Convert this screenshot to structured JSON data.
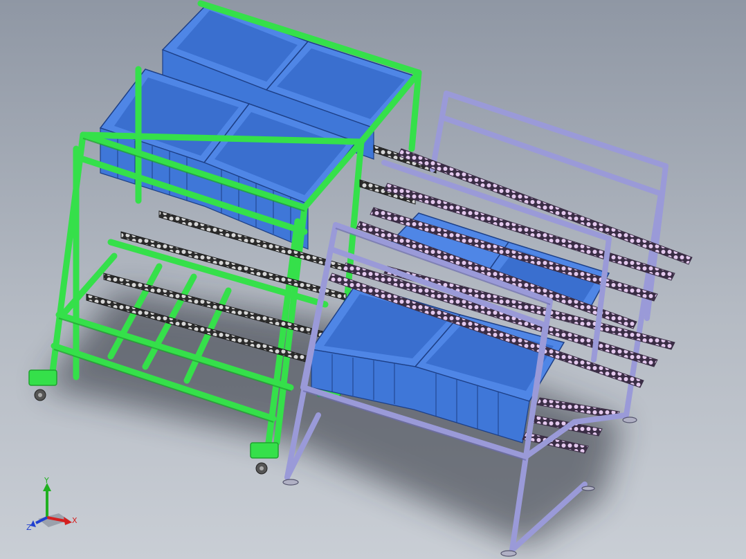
{
  "viewport": {
    "background_top": "#8f97a4",
    "background_bottom": "#c9ced5"
  },
  "model": {
    "green_rack": {
      "frame_color": "#35e04a",
      "frame_dark": "#1ea12e",
      "bin_color": "#4f86e6",
      "bin_dark": "#2f5fb8",
      "upper_bins": 2,
      "lower_bins": 2,
      "roller_tracks": 4,
      "casters": 3
    },
    "purple_rack": {
      "frame_color": "#9a9ad8",
      "frame_dark": "#6c6cae",
      "bin_color": "#4f86e6",
      "rail_color": "#c7a8d8",
      "upper_bins": 2,
      "lower_bins": 2,
      "roller_tracks": 8,
      "leveling_feet": 4
    }
  },
  "triad": {
    "x_label": "X",
    "y_label": "Y",
    "z_label": "Z",
    "x_color": "#d42020",
    "y_color": "#20b020",
    "z_color": "#2040d0"
  }
}
